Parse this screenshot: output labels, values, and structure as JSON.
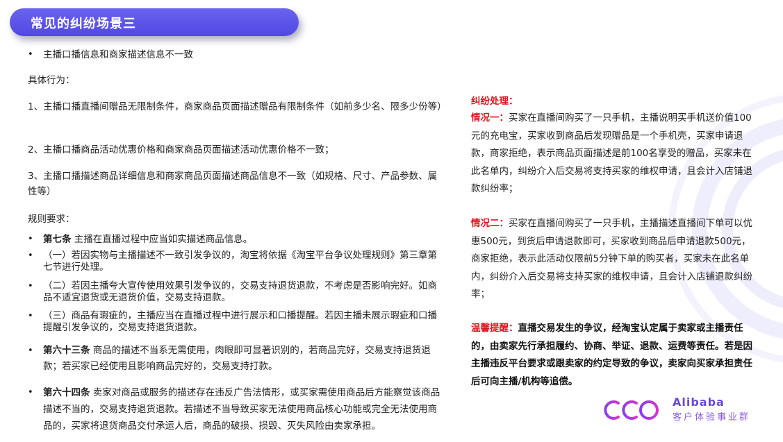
{
  "title": "常见的纠纷场景三",
  "left": {
    "heading_bullet": "主播口播信息和商家描述信息不一致",
    "behaviors_label": "具体行为：",
    "behavior_1": "1、主播口播直播间赠品无限制条件，商家商品页面描述赠品有限制条件（如前多少名、限多少份等）",
    "behavior_2": "2、主播口播商品活动优惠价格和商家商品页面描述活动优惠价格不一致；",
    "behavior_3": "3、主播口播描述商品详细信息和商家商品页面描述商品信息不一致（如规格、尺寸、产品参数、属性等）",
    "rules_label": "规则要求：",
    "rule_7_label": "第七条",
    "rule_7_text": " 主播在直播过程中应当如实描述商品信息。",
    "rule_7_1": "（一）若因实物与主播描述不一致引发争议的，淘宝将依据《淘宝平台争议处理规则》第三章第七节进行处理。",
    "rule_7_2": "（二）若因主播夸大宣传使用效果引发争议的，交易支持退货退款，不考虑是否影响完好。如商品不适宜退货或无退货价值，交易支持退款。",
    "rule_7_3": "（三）商品有瑕疵的，主播应当在直播过程中进行展示和口播提醒。若因主播未展示瑕疵和口播提醒引发争议的，交易支持退货退款。",
    "rule_63_label": "第六十三条",
    "rule_63_text": " 商品的描述不当系无需使用，肉眼即可显著识别的，若商品完好，交易支持退货退款；若买家已经使用且影响商品完好的，交易支持打款。",
    "rule_64_label": "第六十四条",
    "rule_64_text": " 卖家对商品或服务的描述存在违反广告法情形，或买家需使用商品后方能察觉该商品描述不当的，交易支持退货退款。若描述不当导致买家无法使用商品核心功能或完全无法使用商品的，买家将退货商品交付承运人后，商品的破损、损毁、灭失风险由卖家承担。"
  },
  "right": {
    "dispute_label": "纠纷处理：",
    "case1_label": "情况一：",
    "case1_text": "买家在直播间购买了一只手机，主播说明买手机送价值100元的充电宝，买家收到商品后发现赠品是一个手机壳，买家申请退款，商家拒绝，表示商品页面描述是前100名享受的赠品，买家未在此名单内，纠纷介入后交易将支持买家的维权申请，且会计入店铺退款纠纷率；",
    "case2_label": "情况二：",
    "case2_text": "买家在直播间购买了一只手机，主播描述直播间下单可以优惠500元，到货后申请退款即可，买家收到商品后申请退款500元，商家拒绝，表示此活动仅限前5分钟下单的购买者，买家未在此名单内，纠纷介入后交易将支持买家的维权申请，且会计入店铺退款纠纷率；",
    "tip_label": "温馨提醒：",
    "tip_text": "直播交易发生的争议，经淘宝认定属于卖家或主播责任的，由卖家先行承担履约、协商、举证、退款、运费等责任。若是因主播违反平台要求或跟卖家的约定导致的争议，卖家向买家承担责任后可向主播/机构等追偿。"
  },
  "logo": {
    "brand": "Alibaba",
    "sub": "客户体验事业群"
  },
  "colors": {
    "title_bg": "#5a52e8",
    "accent_red": "#e0141e",
    "logo_purple": "#6a49d8"
  }
}
